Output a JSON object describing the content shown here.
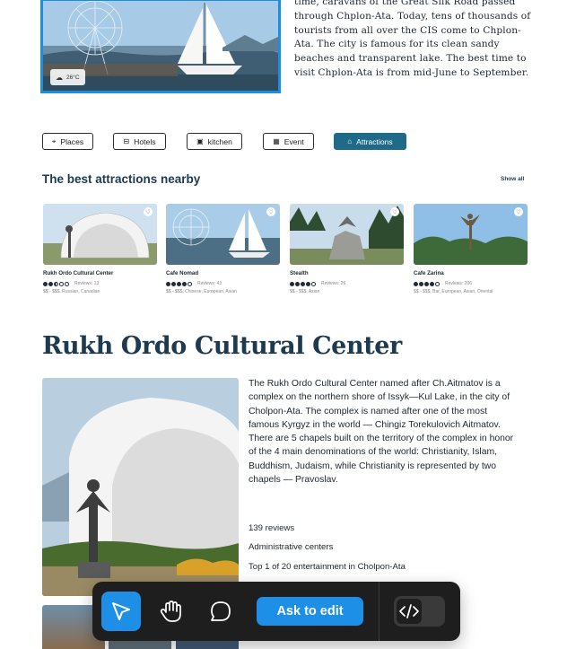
{
  "hero": {
    "weather_label": "26°C",
    "paragraph": "time, caravans of the Great Silk Road passed through Chplon-Ata. Today, tens of thousands of tourists from all over the CIS come to Chplon-Ata. The city is famous for its clean sandy beaches and transparent lake. The best time to visit Chplon-Ata is from mid-June to September."
  },
  "filters": [
    {
      "label": "Places",
      "icon": "map-pin-icon"
    },
    {
      "label": "Hotels",
      "icon": "bed-icon"
    },
    {
      "label": "kitchen",
      "icon": "kitchen-icon"
    },
    {
      "label": "Event",
      "icon": "calendar-icon"
    },
    {
      "label": "Attractions",
      "icon": "landmark-icon",
      "active": true
    }
  ],
  "attractions": {
    "title": "The best attractions nearby",
    "show_all": "Show all",
    "cards": [
      {
        "name": "Rukh Ordo Cultural Center",
        "rating": 2.5,
        "reviews": "Reviews: 13",
        "tags": "$$ - $$$, Russian, Canadian"
      },
      {
        "name": "Cafe Nomad",
        "rating": 4,
        "reviews": "Reviews: 43",
        "tags": "$$ - $$$, Chinese, European, Asian"
      },
      {
        "name": "Stealth",
        "rating": 4,
        "reviews": "Reviews: 26",
        "tags": "$$ - $$$, Asian"
      },
      {
        "name": "Cafe Zarina",
        "rating": 4,
        "reviews": "Reviews: 206",
        "tags": "$$ - $$$, Bar, European, Asian, Oriental"
      }
    ]
  },
  "detail": {
    "title": "Rukh Ordo Cultural Center",
    "description": "The Rukh Ordo Cultural Center named after Ch.Aitmatov is a complex on the northern shore of Issyk—Kul Lake, in the city of Cholpon-Ata. The complex is named after one of the most famous Kyrgyz in the world — Chingiz Torekulovich Aitmatov. There are 5 chapels built on the territory of the complex in honor of the 4 main denominations of the world: Christianity, Islam, Buddhism, Judaism, while Christianity is represented by two chapels — Pravoslav.",
    "reviews": "139 reviews",
    "category": "Administrative centers",
    "ranking": "Top 1 of 20 entertainment in Cholpon-Ata"
  },
  "toolbar": {
    "ask_edit_label": "Ask to edit",
    "tools": [
      "pointer-icon",
      "hand-icon",
      "comment-icon"
    ],
    "active_tool": "pointer-icon",
    "code_icon": "code-icon"
  },
  "colors": {
    "accent": "#1d8fe6",
    "active_filter": "#1f6a89",
    "heading": "#1e3a4e",
    "toolbar_bg": "#1e1e1e"
  }
}
